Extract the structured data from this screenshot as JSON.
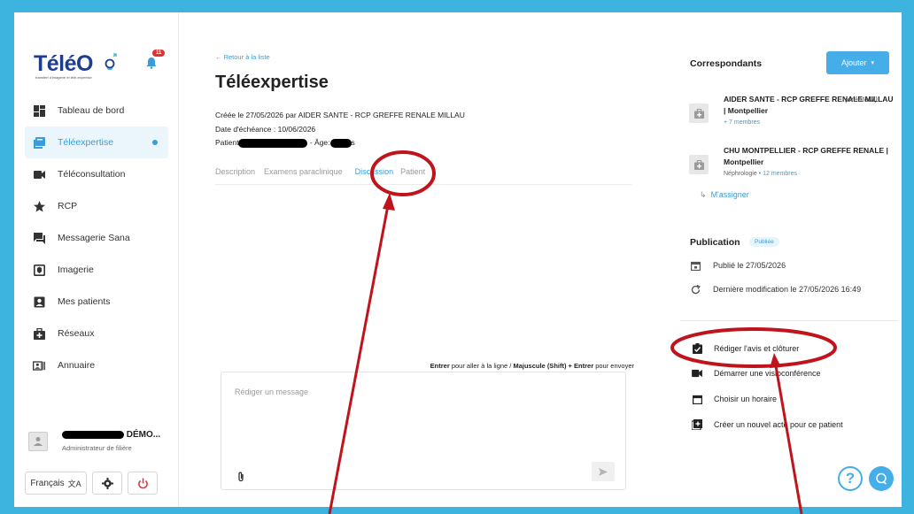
{
  "sidebar": {
    "logo": "TéléO",
    "logo_tagline": "transfert d'imagerie et télé-expertise",
    "notifications_count": "11",
    "items": [
      {
        "label": "Tableau de bord",
        "icon": "dashboard-icon"
      },
      {
        "label": "Téléexpertise",
        "icon": "teleexpertise-icon",
        "active": true
      },
      {
        "label": "Téléconsultation",
        "icon": "video-icon"
      },
      {
        "label": "RCP",
        "icon": "star-icon"
      },
      {
        "label": "Messagerie Sana",
        "icon": "chat-icon"
      },
      {
        "label": "Imagerie",
        "icon": "imaging-icon"
      },
      {
        "label": "Mes patients",
        "icon": "patient-badge-icon"
      },
      {
        "label": "Réseaux",
        "icon": "medical-bag-icon"
      },
      {
        "label": "Annuaire",
        "icon": "contact-card-icon"
      }
    ],
    "user": {
      "name": "DÉMO...",
      "role": "Administrateur de filière"
    },
    "language": "Français"
  },
  "main": {
    "back_link": "Retour à la liste",
    "title": "Téléexpertise",
    "created": "Créée le 27/05/2026 par AIDER SANTE - RCP GREFFE RENALE MILLAU",
    "due": "Date d'échéance : 10/06/2026",
    "patient_label": "Patient",
    "age_label": "- Âge:",
    "age_suffix": "s",
    "tabs": [
      "Description",
      "Examens paraclinique",
      "Discussion",
      "Patient"
    ],
    "active_tab": "Discussion",
    "hint_part1": "Entrer",
    "hint_part2": " pour aller à la ligne / ",
    "hint_part3": "Majuscule (Shift) + Entrer",
    "hint_part4": " pour envoyer",
    "composer_placeholder": "Rédiger un message"
  },
  "right": {
    "correspondents_title": "Correspondants",
    "add_button": "Ajouter",
    "correspondents": [
      {
        "name": "AIDER SANTE - RCP GREFFE RENALE MILLAU | Montpellier",
        "creator": "(créateur)",
        "sub_prefix": "",
        "members": "+ 7 membres"
      },
      {
        "name": "CHU MONTPELLIER - RCP GREFFE RENALE | Montpellier",
        "creator": "",
        "sub_prefix": "Néphrologie",
        "members": " • 12 membres"
      }
    ],
    "assign": "M'assigner",
    "publication_title": "Publication",
    "publication_badge": "Publiée",
    "published": "Publié le 27/05/2026",
    "last_modified": "Dernière modification le 27/05/2026 16:49",
    "actions": [
      {
        "label": "Rédiger l'avis et clôturer",
        "icon": "clipboard-check-icon"
      },
      {
        "label": "Démarrer une visioconférence",
        "icon": "video-icon"
      },
      {
        "label": "Choisir un horaire",
        "icon": "calendar-icon"
      },
      {
        "label": "Créer un nouvel acte pour ce patient",
        "icon": "add-box-icon"
      }
    ]
  },
  "colors": {
    "frame": "#3db3e0",
    "accent": "#3a9cd9",
    "button": "#45aee8",
    "annotation": "#c0141c"
  }
}
